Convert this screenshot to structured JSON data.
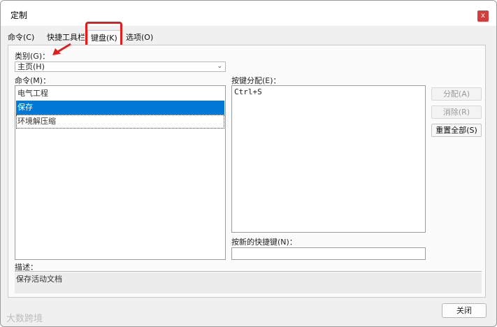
{
  "window": {
    "title": "定制",
    "close_glyph": "x"
  },
  "tabs": [
    {
      "label": "命令(C)"
    },
    {
      "label": "快捷工具栏"
    },
    {
      "label": "键盘(K)"
    },
    {
      "label": "选项(O)"
    }
  ],
  "category": {
    "label": "类别(G)：",
    "value": "主页(H)"
  },
  "commands": {
    "label": "命令(M)：",
    "items": [
      "电气工程",
      "保存",
      "环境解压缩"
    ],
    "selected_index": 1
  },
  "assignments": {
    "label": "按键分配(E)：",
    "keys": [
      "Ctrl+S"
    ]
  },
  "new_shortcut": {
    "label": "按新的快捷键(N)：",
    "value": ""
  },
  "buttons": {
    "assign": "分配(A)",
    "remove": "消除(R)",
    "reset_all": "重置全部(S)"
  },
  "description": {
    "label": "描述：",
    "text": "保存活动文档"
  },
  "footer": {
    "close_label": "关闭"
  },
  "watermark": "大数跨境",
  "colors": {
    "selection": "#0078d7",
    "highlight": "#e31d1d",
    "close_button": "#d33d3d"
  }
}
